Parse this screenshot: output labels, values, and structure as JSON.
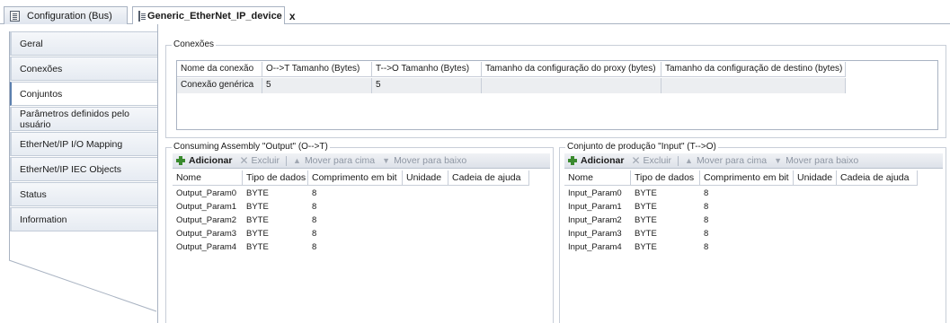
{
  "tabs": [
    {
      "label": "Configuration (Bus)",
      "active": false
    },
    {
      "label": "Generic_EtherNet_IP_device",
      "active": true,
      "close": "x"
    }
  ],
  "nav": {
    "items": [
      {
        "label": "Geral"
      },
      {
        "label": "Conexões"
      },
      {
        "label": "Conjuntos",
        "active": true
      },
      {
        "label": "Parâmetros definidos pelo usuário"
      },
      {
        "label": "EtherNet/IP I/O Mapping"
      },
      {
        "label": "EtherNet/IP IEC Objects"
      },
      {
        "label": "Status"
      },
      {
        "label": "Information"
      }
    ]
  },
  "connections": {
    "title": "Conexões",
    "headers": [
      "Nome da conexão",
      "O-->T Tamanho (Bytes)",
      "T-->O Tamanho (Bytes)",
      "Tamanho da configuração do proxy (bytes)",
      "Tamanho da configuração de destino (bytes)"
    ],
    "rows": [
      [
        "Conexão genérica",
        "5",
        "5",
        "",
        ""
      ]
    ]
  },
  "toolbar": {
    "add": "Adicionar",
    "delete": "Excluir",
    "move_up": "Mover para cima",
    "move_down": "Mover para baixo"
  },
  "consuming": {
    "title": "Consuming Assembly \"Output\" (O-->T)",
    "headers": [
      "Nome",
      "Tipo de dados",
      "Comprimento em bit",
      "Unidade",
      "Cadeia de ajuda"
    ],
    "rows": [
      [
        "Output_Param0",
        "BYTE",
        "8",
        "",
        ""
      ],
      [
        "Output_Param1",
        "BYTE",
        "8",
        "",
        ""
      ],
      [
        "Output_Param2",
        "BYTE",
        "8",
        "",
        ""
      ],
      [
        "Output_Param3",
        "BYTE",
        "8",
        "",
        ""
      ],
      [
        "Output_Param4",
        "BYTE",
        "8",
        "",
        ""
      ]
    ]
  },
  "producing": {
    "title": "Conjunto de produção \"Input\" (T-->O)",
    "headers": [
      "Nome",
      "Tipo de dados",
      "Comprimento em bit",
      "Unidade",
      "Cadeia de ajuda"
    ],
    "rows": [
      [
        "Input_Param0",
        "BYTE",
        "8",
        "",
        ""
      ],
      [
        "Input_Param1",
        "BYTE",
        "8",
        "",
        ""
      ],
      [
        "Input_Param2",
        "BYTE",
        "8",
        "",
        ""
      ],
      [
        "Input_Param3",
        "BYTE",
        "8",
        "",
        ""
      ],
      [
        "Input_Param4",
        "BYTE",
        "8",
        "",
        ""
      ]
    ]
  },
  "colors": {
    "border": "#a9b3c2",
    "accent": "#5b7fae",
    "add_icon": "#3a8a2e",
    "disabled_text": "#8e96a3"
  }
}
